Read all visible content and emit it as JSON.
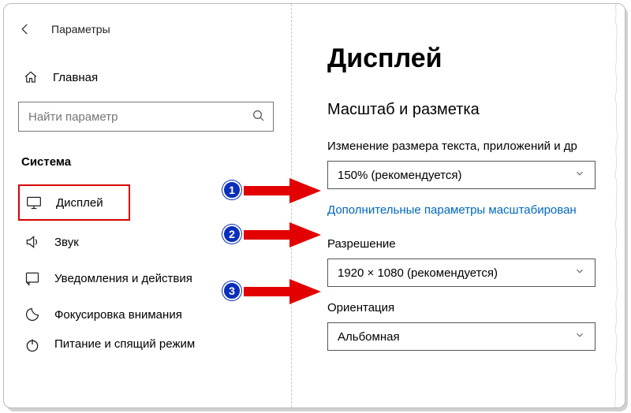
{
  "header": {
    "app_title": "Параметры"
  },
  "home": {
    "label": "Главная"
  },
  "search": {
    "placeholder": "Найти параметр"
  },
  "group": {
    "title": "Система"
  },
  "sidebar": {
    "items": [
      {
        "label": "Дисплей",
        "icon": "monitor-icon",
        "selected": true
      },
      {
        "label": "Звук",
        "icon": "sound-icon"
      },
      {
        "label": "Уведомления и действия",
        "icon": "notifications-icon"
      },
      {
        "label": "Фокусировка внимания",
        "icon": "focus-icon"
      },
      {
        "label": "Питание и спящий режим",
        "icon": "power-icon"
      }
    ]
  },
  "main": {
    "title": "Дисплей",
    "section": "Масштаб и разметка",
    "scale_label": "Изменение размера текста, приложений и др",
    "scale_value": "150% (рекомендуется)",
    "advanced_link": "Дополнительные параметры масштабирован",
    "resolution_label": "Разрешение",
    "resolution_value": "1920 × 1080 (рекомендуется)",
    "orientation_label": "Ориентация",
    "orientation_value": "Альбомная"
  },
  "annotations": {
    "badge1": "1",
    "badge2": "2",
    "badge3": "3"
  }
}
